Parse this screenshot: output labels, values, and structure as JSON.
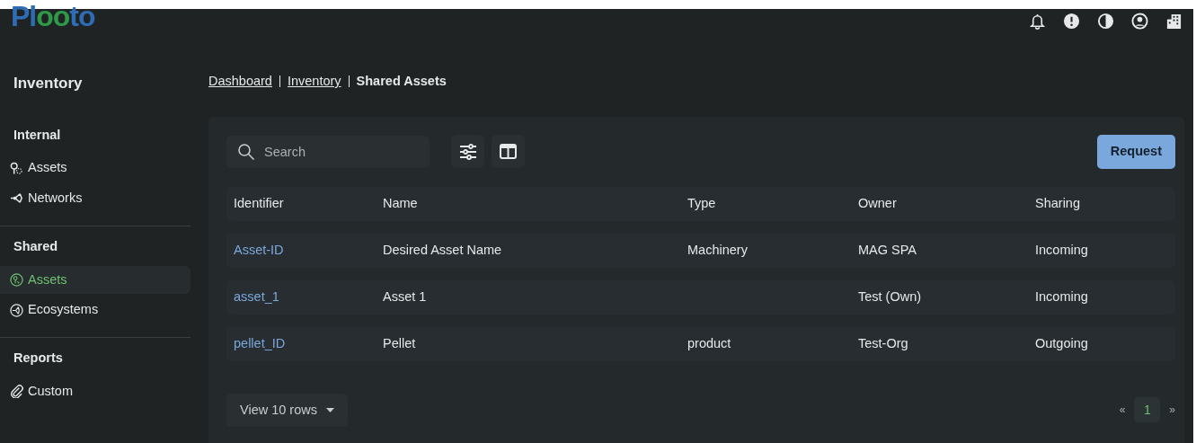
{
  "logo": {
    "text": "Plooto"
  },
  "header_icons": [
    {
      "kind": "bell"
    },
    {
      "kind": "alert"
    },
    {
      "kind": "contrast"
    },
    {
      "kind": "user"
    },
    {
      "kind": "building"
    }
  ],
  "sidebar": {
    "title": "Inventory",
    "sections": [
      {
        "heading": "Internal",
        "items": [
          {
            "label": "Assets",
            "selected": false
          },
          {
            "label": "Networks",
            "selected": false
          }
        ]
      },
      {
        "heading": "Shared",
        "items": [
          {
            "label": "Assets",
            "selected": true
          },
          {
            "label": "Ecosystems",
            "selected": false
          }
        ]
      },
      {
        "heading": "Reports",
        "items": [
          {
            "label": "Custom",
            "selected": false
          }
        ]
      }
    ]
  },
  "breadcrumb": [
    {
      "label": "Dashboard",
      "link": true
    },
    {
      "label": "Inventory",
      "link": true
    },
    {
      "label": "Shared Assets",
      "link": false
    }
  ],
  "search": {
    "placeholder": "Search"
  },
  "request_button": "Request",
  "table": {
    "columns": [
      "Identifier",
      "Name",
      "Type",
      "Owner",
      "Sharing"
    ],
    "rows": [
      [
        "Asset-ID",
        "Desired Asset Name",
        "Machinery",
        "MAG SPA",
        "Incoming"
      ],
      [
        "asset_1",
        "Asset 1",
        "",
        "Test (Own)",
        "Incoming"
      ],
      [
        "pellet_ID",
        "Pellet",
        "product",
        "Test-Org",
        "Outgoing"
      ]
    ]
  },
  "rows_select": "View 10 rows",
  "pagination": {
    "prev": "«",
    "pages": [
      {
        "label": "1",
        "selected": true
      }
    ],
    "next": "»"
  }
}
